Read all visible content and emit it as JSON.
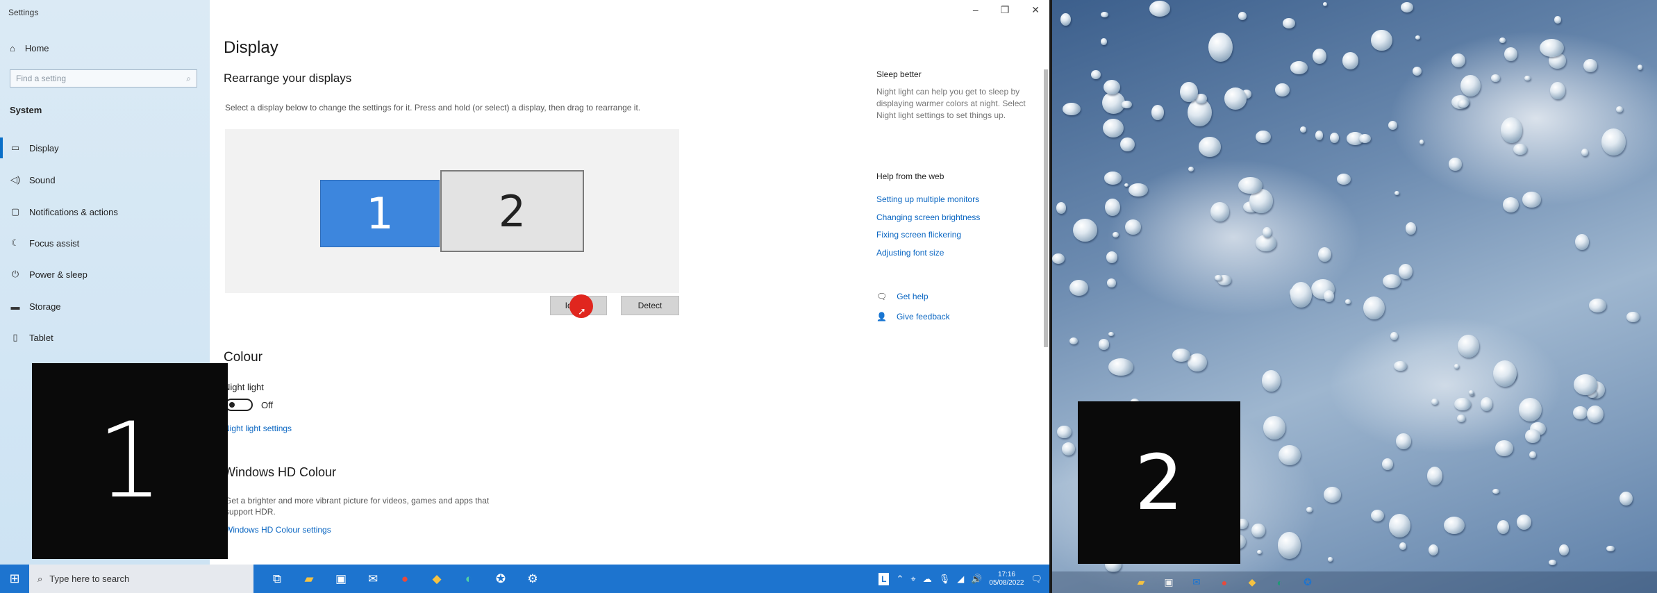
{
  "window": {
    "title": "Settings",
    "controls": [
      "–",
      "❐",
      "✕"
    ]
  },
  "sidebar": {
    "home_label": "Home",
    "search_placeholder": "Find a setting",
    "section_label": "System",
    "items": [
      {
        "label": "Display",
        "icon": "monitor-icon",
        "active": true
      },
      {
        "label": "Sound",
        "icon": "speaker-icon"
      },
      {
        "label": "Notifications & actions",
        "icon": "notification-icon"
      },
      {
        "label": "Focus assist",
        "icon": "moon-icon"
      },
      {
        "label": "Power & sleep",
        "icon": "power-icon"
      },
      {
        "label": "Storage",
        "icon": "storage-icon"
      },
      {
        "label": "Tablet",
        "icon": "tablet-icon"
      }
    ]
  },
  "main": {
    "page_title": "Display",
    "rearrange_heading": "Rearrange your displays",
    "rearrange_desc": "Select a display below to change the settings for it. Press and hold (or select) a display, then drag to rearrange it.",
    "monitor_1_label": "1",
    "monitor_2_label": "2",
    "identify_button": "Identify",
    "detect_button": "Detect",
    "colour_heading": "Colour",
    "night_light_label": "Night light",
    "night_light_state": "Off",
    "night_light_settings_link": "Night light settings",
    "hd_heading": "Windows HD Colour",
    "hd_desc_line1": "Get a brighter and more vibrant picture for videos, games and apps that",
    "hd_desc_line2": "support HDR.",
    "hd_settings_link": "Windows HD Colour settings"
  },
  "right_pane": {
    "sleep_heading": "Sleep better",
    "sleep_text": "Night light can help you get to sleep by displaying warmer colors at night. Select Night light settings to set things up.",
    "web_heading": "Help from the web",
    "web_links": [
      "Setting up multiple monitors",
      "Changing screen brightness",
      "Fixing screen flickering",
      "Adjusting font size"
    ],
    "get_help": "Get help",
    "give_feedback": "Give feedback"
  },
  "identify_overlays": {
    "screen1": "1",
    "screen2": "2"
  },
  "taskbar": {
    "search_placeholder": "Type here to search",
    "language": "L",
    "time": "17:16",
    "date": "05/08/2022"
  },
  "colors": {
    "accent": "#0a6fc8",
    "taskbar": "#1d74cf",
    "monitor_selected": "#3d86dd",
    "cursor_highlight": "#e0261e"
  }
}
